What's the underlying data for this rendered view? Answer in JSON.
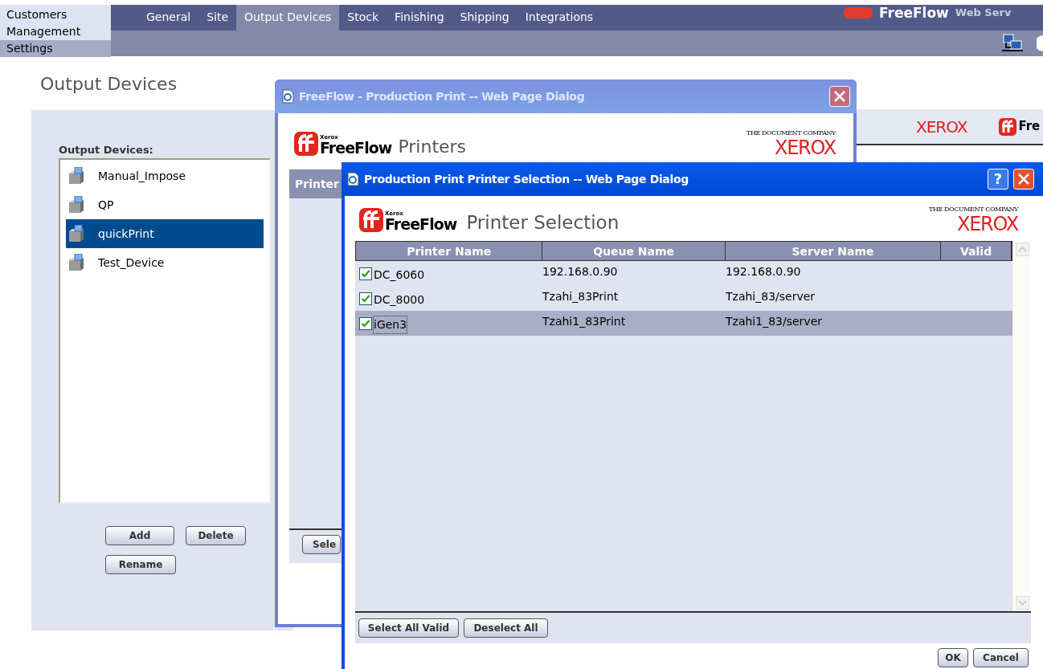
{
  "nav": {
    "items": [
      {
        "label": "Customers",
        "selected": false
      },
      {
        "label": "Management",
        "selected": false
      },
      {
        "label": "Settings",
        "selected": true
      }
    ]
  },
  "tabs": [
    {
      "label": "General",
      "selected": false
    },
    {
      "label": "Site",
      "selected": false
    },
    {
      "label": "Output Devices",
      "selected": true
    },
    {
      "label": "Stock",
      "selected": false
    },
    {
      "label": "Finishing",
      "selected": false
    },
    {
      "label": "Shipping",
      "selected": false
    },
    {
      "label": "Integrations",
      "selected": false
    }
  ],
  "header_logo": {
    "brand": "FreeFlow",
    "product": "Web Serv"
  },
  "page": {
    "title": "Output Devices",
    "list_label": "Output Devices:",
    "devices": [
      {
        "name": "Manual_Impose",
        "selected": false
      },
      {
        "name": "QP",
        "selected": false
      },
      {
        "name": "quickPrint",
        "selected": true
      },
      {
        "name": "Test_Device",
        "selected": false
      }
    ],
    "buttons": [
      "Add",
      "Delete",
      "Rename"
    ]
  },
  "background_strip": {
    "xerox": "XEROX",
    "brand": "Fre"
  },
  "dialog_back": {
    "title": "FreeFlow - Production Print -- Web Page Dialog",
    "logo_small": "Xerox",
    "logo_brand": "FreeFlow",
    "heading": "Printers",
    "tagline": "THE DOCUMENT COMPANY",
    "xerox": "XEROX",
    "column_1": "Printer",
    "button": "Sele"
  },
  "dialog_front": {
    "title": "Production Print Printer Selection -- Web Page Dialog",
    "help": "?",
    "logo_small": "Xerox",
    "logo_brand": "FreeFlow",
    "heading": "Printer Selection",
    "tagline": "THE DOCUMENT COMPANY",
    "xerox": "XEROX",
    "columns": [
      "Printer Name",
      "Queue Name",
      "Server Name",
      "Valid"
    ],
    "rows": [
      {
        "checked": true,
        "selected": false,
        "cells": [
          "DC_6060",
          "192.168.0.90",
          "192.168.0.90"
        ]
      },
      {
        "checked": true,
        "selected": false,
        "cells": [
          "DC_8000",
          "Tzahi_83Print",
          "Tzahi_83/server"
        ]
      },
      {
        "checked": true,
        "selected": true,
        "cells": [
          "iGen3",
          "Tzahi1_83Print",
          "Tzahi1_83/server"
        ]
      }
    ],
    "buttons": [
      "Select All Valid",
      "Deselect All"
    ],
    "footer_buttons": [
      "OK",
      "Cancel"
    ]
  }
}
